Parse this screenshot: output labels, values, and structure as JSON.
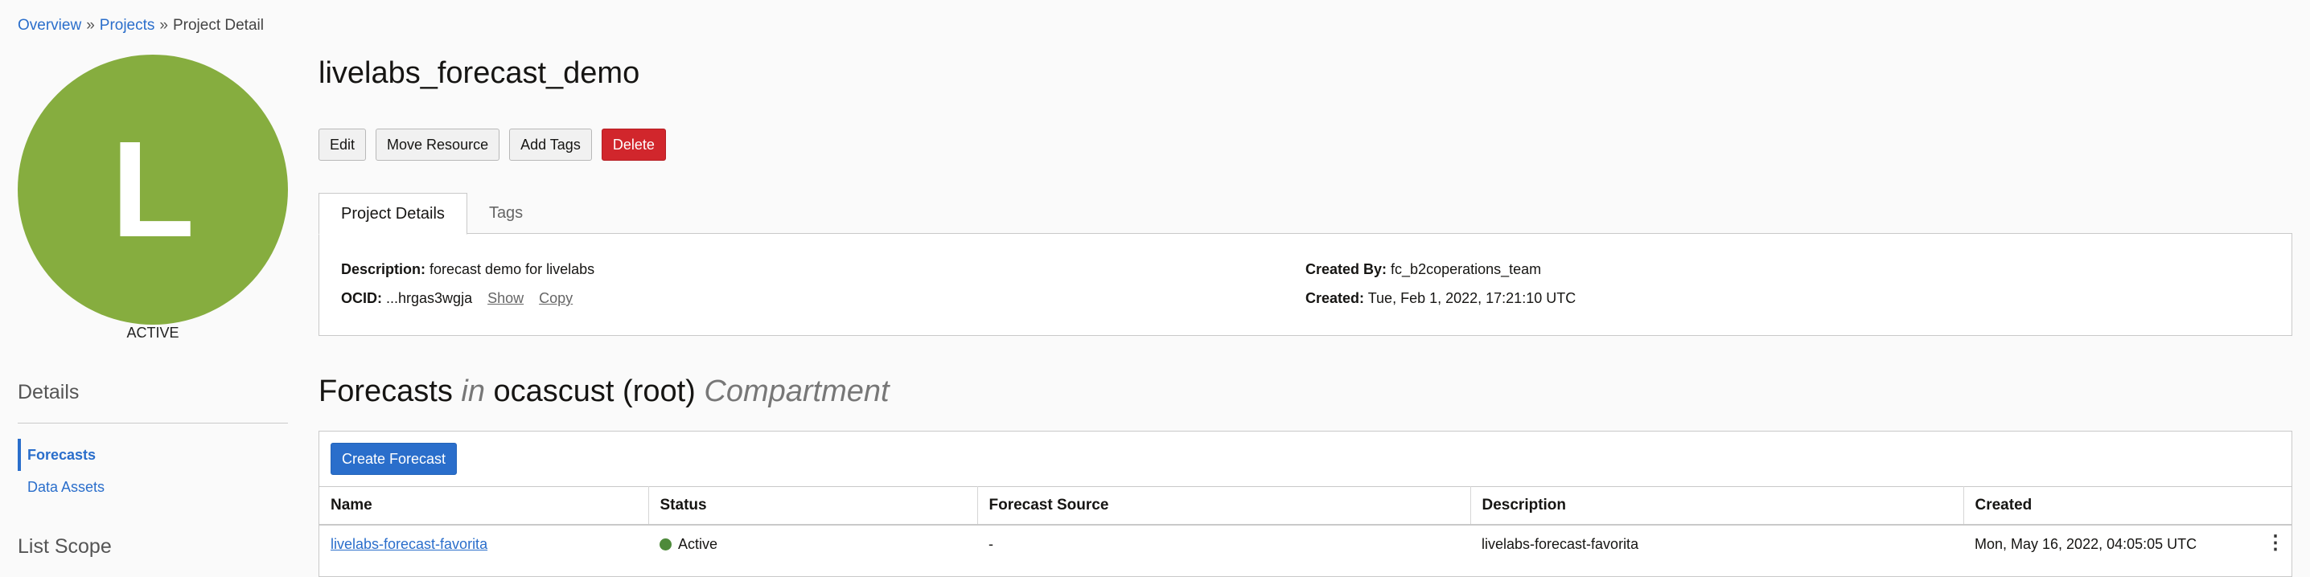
{
  "breadcrumb": {
    "overview": "Overview",
    "projects": "Projects",
    "current": "Project Detail",
    "sep": "»"
  },
  "avatar": {
    "letter": "L",
    "status": "ACTIVE",
    "color": "#86ad3f"
  },
  "left": {
    "details_heading": "Details",
    "nav": [
      {
        "label": "Forecasts",
        "active": true
      },
      {
        "label": "Data Assets",
        "active": false
      }
    ],
    "list_scope_heading": "List Scope"
  },
  "page_title": "livelabs_forecast_demo",
  "actions": {
    "edit": "Edit",
    "move": "Move Resource",
    "add_tags": "Add Tags",
    "delete": "Delete"
  },
  "tabs": [
    {
      "label": "Project Details",
      "active": true
    },
    {
      "label": "Tags",
      "active": false
    }
  ],
  "details": {
    "description_label": "Description:",
    "description": "forecast demo for livelabs",
    "ocid_label": "OCID:",
    "ocid": "...hrgas3wgja",
    "show": "Show",
    "copy": "Copy",
    "created_by_label": "Created By:",
    "created_by": "fc_b2coperations_team",
    "created_label": "Created:",
    "created": "Tue, Feb 1, 2022, 17:21:10 UTC"
  },
  "forecasts": {
    "title_main": "Forecasts",
    "title_in": "in",
    "compartment": "ocascust (root)",
    "title_suffix": "Compartment",
    "create_button": "Create Forecast",
    "columns": [
      "Name",
      "Status",
      "Forecast Source",
      "Description",
      "Created"
    ],
    "rows": [
      {
        "name": "livelabs-forecast-favorita",
        "status": "Active",
        "status_color": "#4e8a3b",
        "source": "-",
        "description": "livelabs-forecast-favorita",
        "created": "Mon, May 16, 2022, 04:05:05 UTC"
      }
    ]
  },
  "colors": {
    "accent": "#2a6ecb",
    "danger": "#d1262c"
  }
}
